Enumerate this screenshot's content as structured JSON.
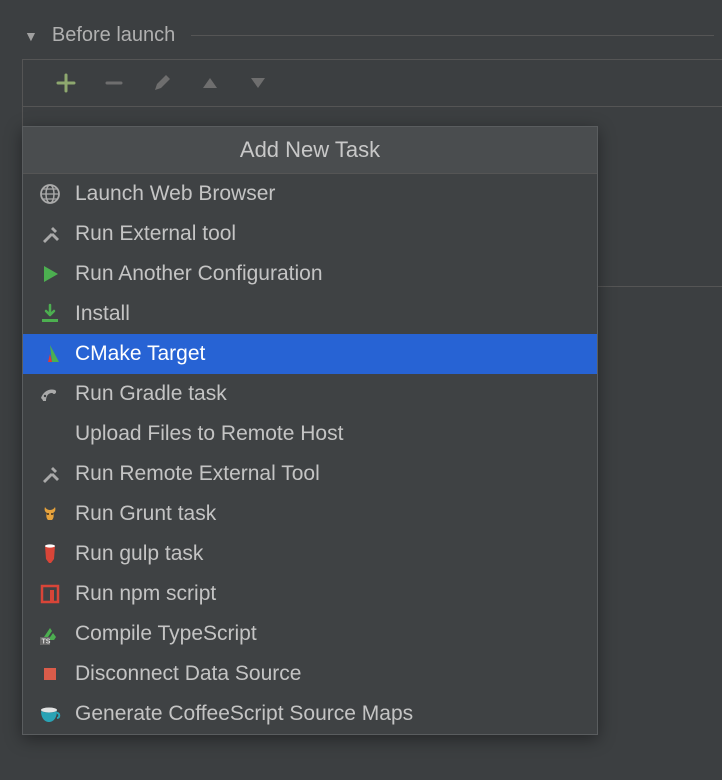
{
  "section": {
    "title": "Before launch"
  },
  "toolbar": {
    "add": "+",
    "remove": "−",
    "edit": "edit",
    "up": "▲",
    "down": "▼"
  },
  "popup": {
    "title": "Add New Task",
    "items": [
      {
        "icon": "globe-icon",
        "label": "Launch Web Browser",
        "selected": false
      },
      {
        "icon": "tools-icon",
        "label": "Run External tool",
        "selected": false
      },
      {
        "icon": "play-icon",
        "label": "Run Another Configuration",
        "selected": false
      },
      {
        "icon": "install-icon",
        "label": "Install",
        "selected": false
      },
      {
        "icon": "cmake-icon",
        "label": "CMake Target",
        "selected": true
      },
      {
        "icon": "gradle-icon",
        "label": "Run Gradle task",
        "selected": false
      },
      {
        "icon": "blank-icon",
        "label": "Upload Files to Remote Host",
        "selected": false
      },
      {
        "icon": "tools-icon",
        "label": "Run Remote External Tool",
        "selected": false
      },
      {
        "icon": "grunt-icon",
        "label": "Run Grunt task",
        "selected": false
      },
      {
        "icon": "gulp-icon",
        "label": "Run gulp task",
        "selected": false
      },
      {
        "icon": "npm-icon",
        "label": "Run npm script",
        "selected": false
      },
      {
        "icon": "typescript-icon",
        "label": "Compile TypeScript",
        "selected": false
      },
      {
        "icon": "disconnect-icon",
        "label": "Disconnect Data Source",
        "selected": false
      },
      {
        "icon": "coffeescript-icon",
        "label": "Generate CoffeeScript Source Maps",
        "selected": false
      }
    ]
  }
}
